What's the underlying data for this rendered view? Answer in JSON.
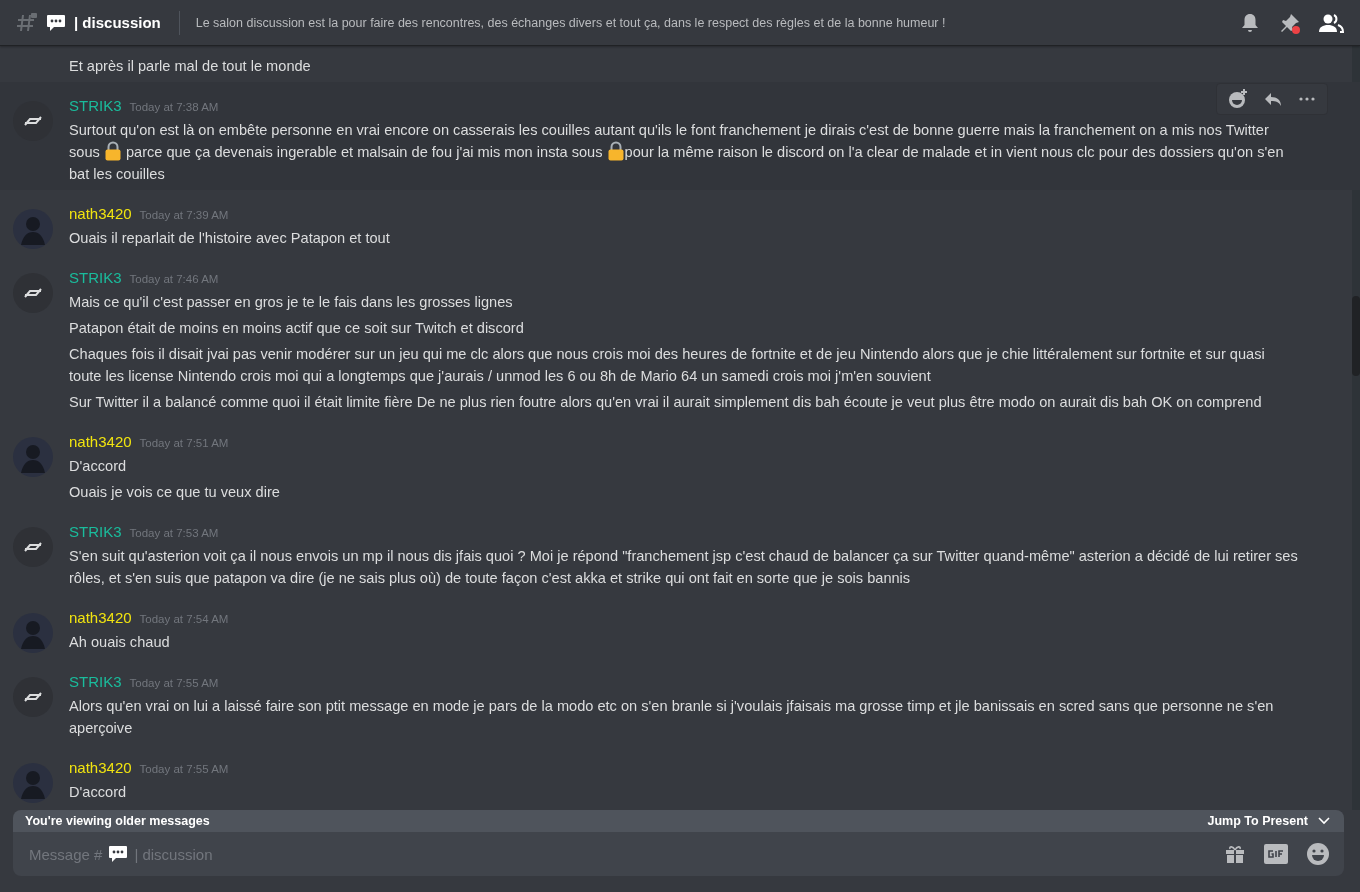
{
  "header": {
    "channel_prefix": "|",
    "channel_name": "discussion",
    "topic": "Le salon discussion est la pour faire des rencontres, des échanges divers et tout ça, dans le respect des règles et de la bonne humeur !",
    "pins_unread": true
  },
  "messages": [
    {
      "kind": "continuation",
      "hovered": false,
      "lines": [
        [
          {
            "kind": "text",
            "text": "Et après il parle mal de tout le monde"
          }
        ]
      ]
    },
    {
      "kind": "logo",
      "author": "STRIK3",
      "color": "#1abc9c",
      "time": "Today at 7:38 AM",
      "hovered": true,
      "lines": [
        [
          {
            "kind": "text",
            "text": "Surtout qu'on est là on embête personne en vrai encore on casserais les couilles autant qu'ils le font franchement je dirais c'est de bonne guerre mais la franchement on a mis nos Twitter sous "
          },
          {
            "kind": "lock"
          },
          {
            "kind": "text",
            "text": " parce que ça devenais ingerable et malsain de fou j'ai mis mon insta sous "
          },
          {
            "kind": "lock"
          },
          {
            "kind": "text",
            "text": "pour la même raison le discord on l'a clear de malade et in vient nous clc pour des dossiers qu'on s'en bat les couilles"
          }
        ]
      ]
    },
    {
      "kind": "photo",
      "author": "nath3420",
      "color": "#f1e40f",
      "time": "Today at 7:39 AM",
      "hovered": false,
      "lines": [
        [
          {
            "kind": "text",
            "text": "Ouais il reparlait de l'histoire avec Patapon et tout"
          }
        ]
      ]
    },
    {
      "kind": "logo",
      "author": "STRIK3",
      "color": "#1abc9c",
      "time": "Today at 7:46 AM",
      "hovered": false,
      "lines": [
        [
          {
            "kind": "text",
            "text": "Mais ce qu'il c'est passer en gros je te le fais dans les grosses lignes"
          }
        ],
        [
          {
            "kind": "text",
            "text": "Patapon était de moins en moins actif que ce soit sur Twitch et discord"
          }
        ],
        [
          {
            "kind": "text",
            "text": "Chaques fois il disait jvai pas venir modérer sur un jeu qui me clc alors que nous crois moi des heures de fortnite et de jeu Nintendo alors que je chie littéralement sur fortnite et sur quasi toute les license Nintendo crois moi qui a longtemps que j'aurais / unmod les 6 ou 8h de Mario 64 un samedi crois moi j'm'en souvient"
          }
        ],
        [
          {
            "kind": "text",
            "text": "Sur Twitter il a balancé comme quoi il était limite fière De ne plus rien foutre alors qu'en vrai il aurait simplement dis bah écoute je veut plus être modo on aurait dis bah OK on comprend"
          }
        ]
      ]
    },
    {
      "kind": "photo",
      "author": "nath3420",
      "color": "#f1e40f",
      "time": "Today at 7:51 AM",
      "hovered": false,
      "lines": [
        [
          {
            "kind": "text",
            "text": "D'accord"
          }
        ],
        [
          {
            "kind": "text",
            "text": "Ouais je vois ce que tu veux dire"
          }
        ]
      ]
    },
    {
      "kind": "logo",
      "author": "STRIK3",
      "color": "#1abc9c",
      "time": "Today at 7:53 AM",
      "hovered": false,
      "lines": [
        [
          {
            "kind": "text",
            "text": "S'en suit qu'asterion voit ça il nous envois un mp il nous dis jfais quoi ? Moi je répond \"franchement jsp c'est chaud de balancer ça sur Twitter quand-même\" asterion a décidé de lui retirer ses rôles, et s'en suis que patapon va dire (je ne sais plus où) de toute façon c'est akka et strike qui ont fait en sorte que je sois bannis"
          }
        ]
      ]
    },
    {
      "kind": "photo",
      "author": "nath3420",
      "color": "#f1e40f",
      "time": "Today at 7:54 AM",
      "hovered": false,
      "lines": [
        [
          {
            "kind": "text",
            "text": "Ah ouais chaud"
          }
        ]
      ]
    },
    {
      "kind": "logo",
      "author": "STRIK3",
      "color": "#1abc9c",
      "time": "Today at 7:55 AM",
      "hovered": false,
      "lines": [
        [
          {
            "kind": "text",
            "text": "Alors qu'en vrai on lui a laissé faire son ptit message en mode je pars de la modo etc on s'en branle si j'voulais jfaisais ma grosse timp et jle banissais en scred sans que personne ne s'en aperçoive"
          }
        ]
      ]
    },
    {
      "kind": "photo",
      "author": "nath3420",
      "color": "#f1e40f",
      "time": "Today at 7:55 AM",
      "hovered": false,
      "lines": [
        [
          {
            "kind": "text",
            "text": "D'accord"
          }
        ]
      ]
    }
  ],
  "older_banner": {
    "text": "You're viewing older messages",
    "action": "Jump To Present"
  },
  "composer": {
    "placeholder_prefix": "Message #",
    "placeholder_suffix": "| discussion"
  }
}
